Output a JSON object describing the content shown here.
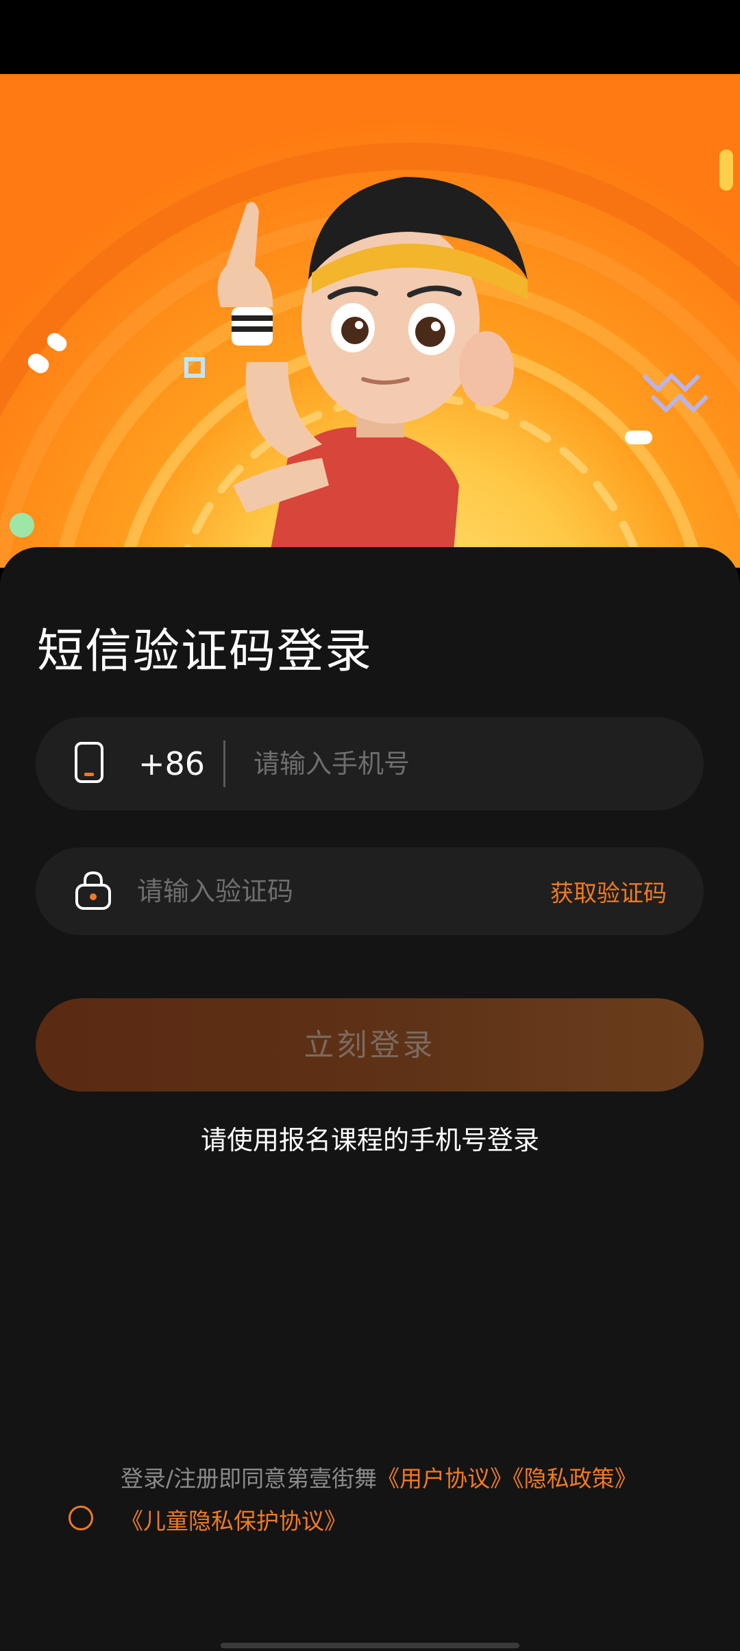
{
  "header": {
    "title": "短信验证码登录"
  },
  "phone_field": {
    "country_code": "+86",
    "placeholder": "请输入手机号",
    "value": ""
  },
  "code_field": {
    "placeholder": "请输入验证码",
    "value": "",
    "get_code_label": "获取验证码"
  },
  "login_button": {
    "label": "立刻登录"
  },
  "hint": "请使用报名课程的手机号登录",
  "agreement": {
    "prefix": "登录/注册即同意第壹街舞",
    "user_agreement": "《用户协议》",
    "privacy_policy": "《隐私政策》",
    "child_privacy": "《儿童隐私保护协议》"
  },
  "colors": {
    "accent": "#f07a22",
    "background": "#141414",
    "field": "#1f1f1f"
  },
  "icons": {
    "phone_field": "phone-icon",
    "code_field": "lock-icon"
  }
}
